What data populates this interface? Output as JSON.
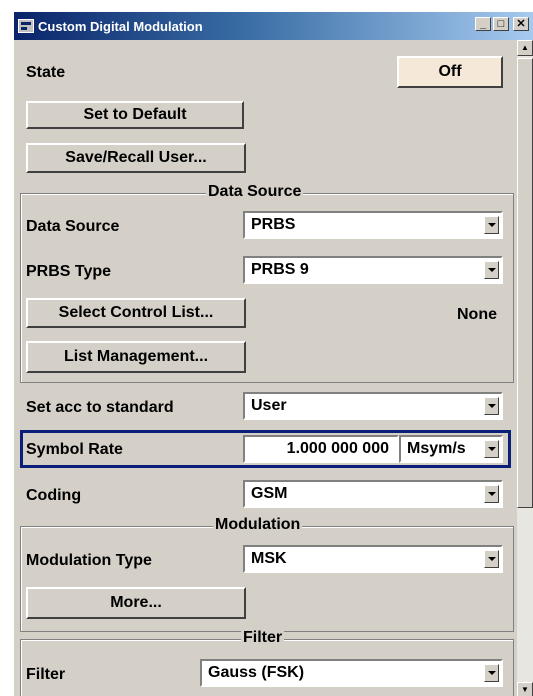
{
  "window": {
    "title": "Custom Digital Modulation"
  },
  "state": {
    "label": "State",
    "value": "Off"
  },
  "buttons": {
    "set_default": "Set to Default",
    "save_recall": "Save/Recall User..."
  },
  "data_source_group": {
    "title": "Data Source",
    "data_source_label": "Data Source",
    "data_source_value": "PRBS",
    "prbs_type_label": "PRBS Type",
    "prbs_type_value": "PRBS 9",
    "select_control_list": "Select Control List...",
    "control_list_value": "None",
    "list_management": "List Management..."
  },
  "standard": {
    "label": "Set acc to standard",
    "value": "User"
  },
  "symbol_rate": {
    "label": "Symbol Rate",
    "value": "1.000 000 000",
    "unit": "Msym/s"
  },
  "coding": {
    "label": "Coding",
    "value": "GSM"
  },
  "modulation_group": {
    "title": "Modulation",
    "type_label": "Modulation Type",
    "type_value": "MSK",
    "more": "More..."
  },
  "filter_group": {
    "title": "Filter",
    "label": "Filter",
    "value": "Gauss (FSK)"
  },
  "colors": {
    "title_bar": "#0a246a",
    "highlight": "#0a1f7a",
    "state_button": "#f5e8d8"
  },
  "icons": {
    "window_buttons": [
      "minimize-icon",
      "maximize-icon",
      "close-icon"
    ]
  }
}
